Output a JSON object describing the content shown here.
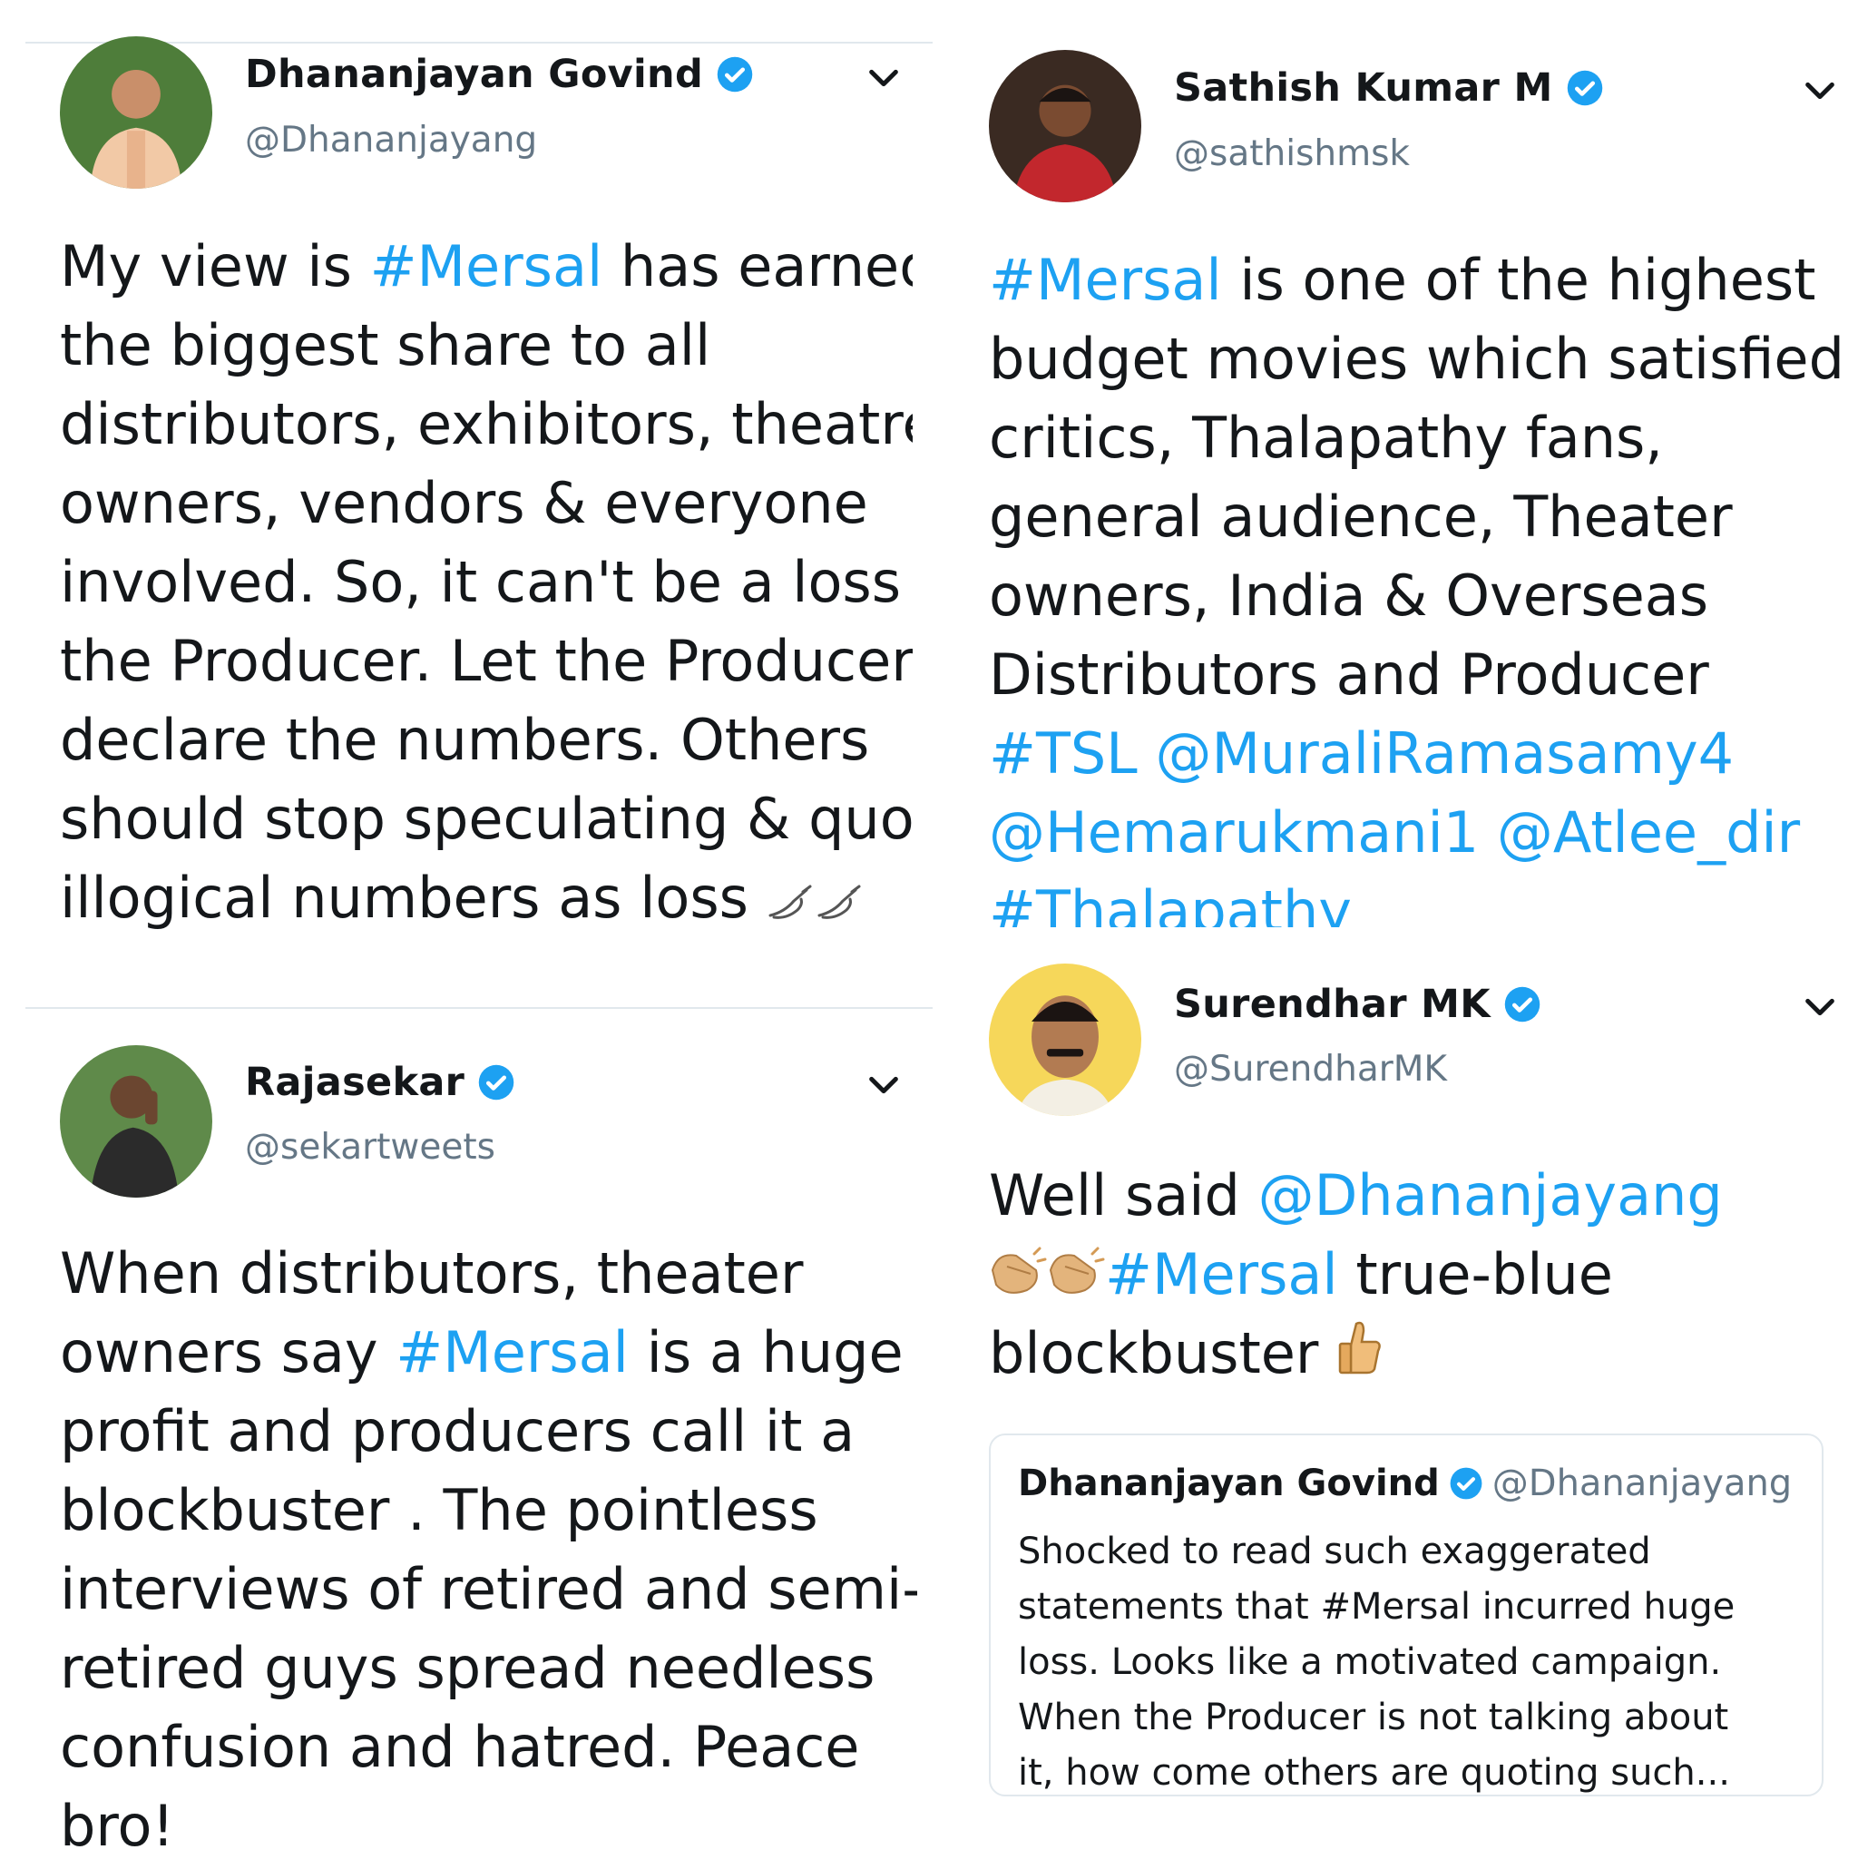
{
  "tweets": [
    {
      "name": "Dhananjayan Govind",
      "handle": "@Dhananjayang",
      "avatar_icon": "person-avatar-icon",
      "lines": [
        [
          {
            "t": "My view is "
          },
          {
            "t": "#Mersal",
            "link": true
          },
          {
            "t": " has earned"
          }
        ],
        [
          {
            "t": "the biggest share to all"
          }
        ],
        [
          {
            "t": "distributors, exhibitors, theatre"
          }
        ],
        [
          {
            "t": "owners, vendors & everyone"
          }
        ],
        [
          {
            "t": "involved. So, it can't be a loss to"
          }
        ],
        [
          {
            "t": "the Producer. Let the Producer"
          }
        ],
        [
          {
            "t": "declare the numbers. Others"
          }
        ],
        [
          {
            "t": "should stop speculating & quote"
          }
        ],
        [
          {
            "t": "illogical numbers as loss "
          },
          {
            "emoji": "writing-hand-icon"
          },
          {
            "emoji": "writing-hand-icon"
          }
        ]
      ]
    },
    {
      "name": "Sathish Kumar M",
      "handle": "@sathishmsk",
      "avatar_icon": "person-avatar-icon",
      "lines": [
        [
          {
            "t": "#Mersal",
            "link": true
          },
          {
            "t": " is one of the highest"
          }
        ],
        [
          {
            "t": "budget movies which satisfied"
          }
        ],
        [
          {
            "t": "critics, Thalapathy fans,"
          }
        ],
        [
          {
            "t": "general audience, Theater"
          }
        ],
        [
          {
            "t": "owners, India & Overseas"
          }
        ],
        [
          {
            "t": "Distributors and Producer"
          }
        ],
        [
          {
            "t": "#TSL",
            "link": true
          },
          {
            "t": " "
          },
          {
            "t": "@MuraliRamasamy4",
            "link": true
          }
        ],
        [
          {
            "t": "@Hemarukmani1",
            "link": true
          },
          {
            "t": "  "
          },
          {
            "t": "@Atlee_dir",
            "link": true
          }
        ],
        [
          {
            "t": "#Thalapathy",
            "link": true
          }
        ]
      ]
    },
    {
      "name": "Rajasekar",
      "handle": "@sekartweets",
      "avatar_icon": "person-avatar-icon",
      "lines": [
        [
          {
            "t": "When distributors, theater"
          }
        ],
        [
          {
            "t": "owners say "
          },
          {
            "t": "#Mersal",
            "link": true
          },
          {
            "t": " is a huge"
          }
        ],
        [
          {
            "t": "profit and producers call it a"
          }
        ],
        [
          {
            "t": "blockbuster . The pointless"
          }
        ],
        [
          {
            "t": "interviews of retired and semi-"
          }
        ],
        [
          {
            "t": "retired guys spread needless"
          }
        ],
        [
          {
            "t": "confusion and hatred. Peace"
          }
        ],
        [
          {
            "t": "bro!"
          }
        ]
      ]
    },
    {
      "name": "Surendhar MK",
      "handle": "@SurendharMK",
      "avatar_icon": "person-avatar-icon",
      "lines": [
        [
          {
            "t": "Well said "
          },
          {
            "t": "@Dhananjayang",
            "link": true
          }
        ],
        [
          {
            "emoji": "clapping-hands-icon"
          },
          {
            "emoji": "clapping-hands-icon"
          },
          {
            "t": "#Mersal",
            "link": true
          },
          {
            "t": " true-blue"
          }
        ],
        [
          {
            "t": "blockbuster    "
          },
          {
            "emoji": "thumbs-up-icon"
          }
        ]
      ],
      "quote": {
        "name": "Dhananjayan Govind",
        "handle": "@Dhananjayang",
        "lines": [
          "Shocked to read such exaggerated",
          "statements that #Mersal incurred huge",
          "loss. Looks like a motivated campaign.",
          "When the Producer is not talking about",
          "it, how come others are quoting such..."
        ]
      }
    }
  ],
  "colors": {
    "link": "#1da1f2",
    "text": "#14171a",
    "secondary": "#657786",
    "divider": "#e1e8ed",
    "verified": "#1da1f2"
  }
}
